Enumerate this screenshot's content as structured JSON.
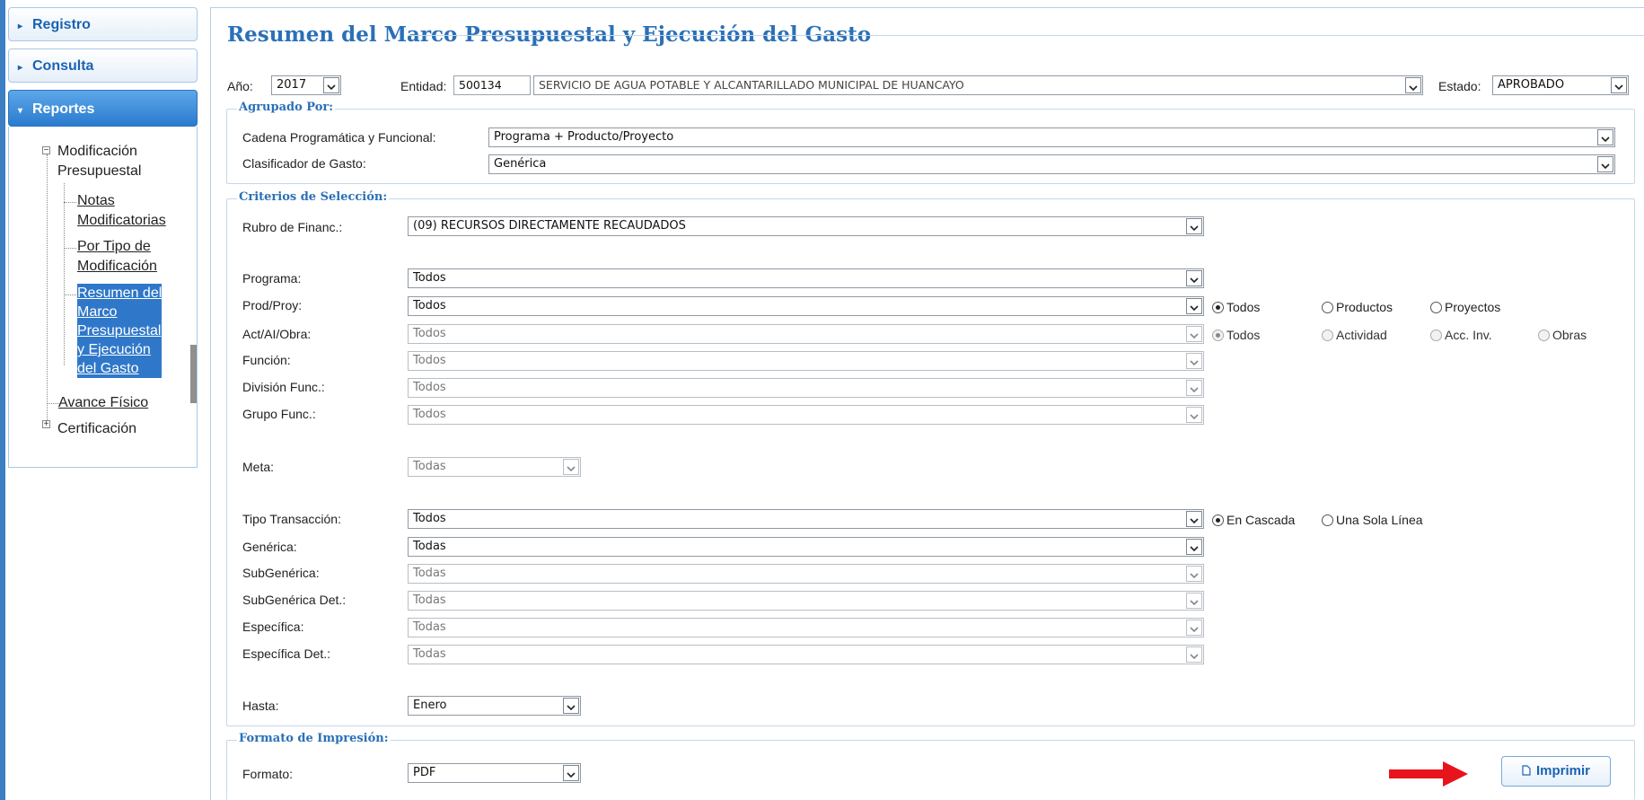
{
  "sidebar": {
    "headers": [
      {
        "label": "Registro"
      },
      {
        "label": "Consulta"
      },
      {
        "label": "Reportes"
      }
    ],
    "tree": {
      "modificacion_l1": "Modificación",
      "modificacion_l2": "Presupuestal",
      "notas_l1": "Notas",
      "notas_l2": "Modificatorias",
      "portipo_l1": "Por Tipo de",
      "portipo_l2": "Modificación",
      "resumen_l1": "Resumen del",
      "resumen_l2": "Marco",
      "resumen_l3": "Presupuestal",
      "resumen_l4": "y Ejecución",
      "resumen_l5": "del Gasto",
      "avance": "Avance Físico",
      "certificacion": "Certificación"
    }
  },
  "main": {
    "title": "Resumen del Marco Presupuestal y Ejecución del Gasto",
    "top": {
      "anio_label": "Año:",
      "anio_value": "2017",
      "entidad_label": "Entidad:",
      "entidad_code": "500134",
      "entidad_name": "SERVICIO DE AGUA POTABLE Y ALCANTARILLADO MUNICIPAL DE HUANCAYO",
      "estado_label": "Estado:",
      "estado_value": "APROBADO"
    },
    "agrupado": {
      "legend": "Agrupado Por:",
      "cadena_label": "Cadena Programática y Funcional:",
      "cadena_value": "Programa + Producto/Proyecto",
      "clasif_label": "Clasificador de Gasto:",
      "clasif_value": "Genérica"
    },
    "criterios": {
      "legend": "Criterios de Selección:",
      "rubro_label": "Rubro de Financ.:",
      "rubro_value": "(09) RECURSOS DIRECTAMENTE RECAUDADOS",
      "programa_label": "Programa:",
      "programa_value": "Todos",
      "prodproy_label": "Prod/Proy:",
      "prodproy_value": "Todos",
      "act_label": "Act/AI/Obra:",
      "act_value": "Todos",
      "funcion_label": "Función:",
      "funcion_value": "Todos",
      "division_label": "División Func.:",
      "division_value": "Todos",
      "grupo_label": "Grupo Func.:",
      "grupo_value": "Todos",
      "meta_label": "Meta:",
      "meta_value": "Todas",
      "tipo_label": "Tipo Transacción:",
      "tipo_value": "Todos",
      "generica_label": "Genérica:",
      "generica_value": "Todas",
      "subgen_label": "SubGenérica:",
      "subgen_value": "Todas",
      "subgendet_label": "SubGenérica Det.:",
      "subgendet_value": "Todas",
      "especifica_label": "Específica:",
      "especifica_value": "Todas",
      "especificadet_label": "Específica Det.:",
      "especificadet_value": "Todas",
      "hasta_label": "Hasta:",
      "hasta_value": "Enero",
      "radios_prod": {
        "todos": "Todos",
        "productos": "Productos",
        "proyectos": "Proyectos"
      },
      "radios_act": {
        "todos": "Todos",
        "actividad": "Actividad",
        "accinv": "Acc. Inv.",
        "obras": "Obras"
      },
      "radios_tipo": {
        "cascada": "En Cascada",
        "sola": "Una Sola Línea"
      }
    },
    "formato": {
      "legend": "Formato de Impresión:",
      "label": "Formato:",
      "value": "PDF",
      "print_label": "Imprimir"
    }
  },
  "colors": {
    "accent": "#2a70b8",
    "sidebar_active": "#2a7bcf",
    "arrow": "#e8141c"
  }
}
